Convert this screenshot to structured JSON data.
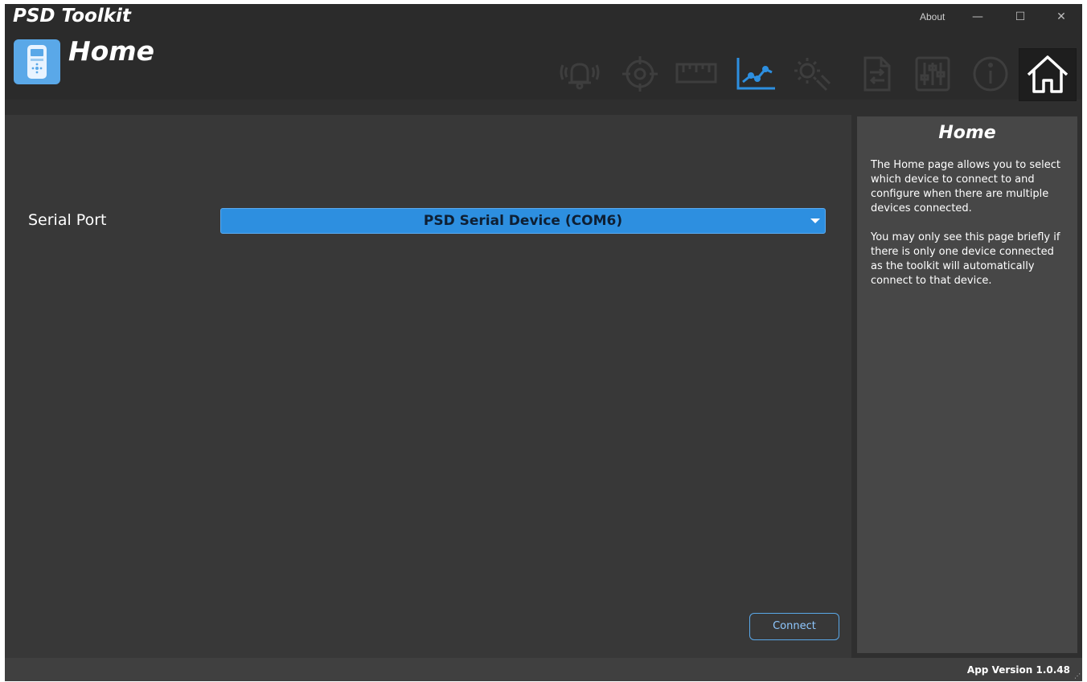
{
  "window": {
    "app_title": "PSD Toolkit",
    "about_label": "About",
    "minimize_symbol": "—",
    "maximize_symbol": "☐",
    "close_symbol": "✕"
  },
  "header": {
    "page_title": "Home",
    "device_icon": "handheld-device-icon",
    "nav_icons": [
      {
        "name": "alarm-bell-icon",
        "active": false
      },
      {
        "name": "target-crosshair-icon",
        "active": false
      },
      {
        "name": "ruler-icon",
        "active": false
      },
      {
        "name": "line-chart-icon",
        "active": true
      },
      {
        "name": "gear-wrench-icon",
        "active": false
      },
      {
        "name": "document-transfer-icon",
        "active": false
      },
      {
        "name": "sliders-icon",
        "active": false
      },
      {
        "name": "info-icon",
        "active": false
      },
      {
        "name": "home-icon",
        "active": true
      }
    ]
  },
  "main": {
    "serial_port_label": "Serial Port",
    "serial_port_value": "PSD Serial Device (COM6)",
    "connect_label": "Connect"
  },
  "help": {
    "title": "Home",
    "paragraph_1": "The Home page allows you to select which device to connect to and configure when there are multiple devices connected.",
    "paragraph_2": "You may only see this page briefly if there is only one device connected as the toolkit will automatically connect to that device."
  },
  "status": {
    "app_version": "App Version 1.0.48"
  },
  "colors": {
    "accent": "#2d8fe0",
    "background": "#2f2f2f",
    "panel": "#474747"
  }
}
